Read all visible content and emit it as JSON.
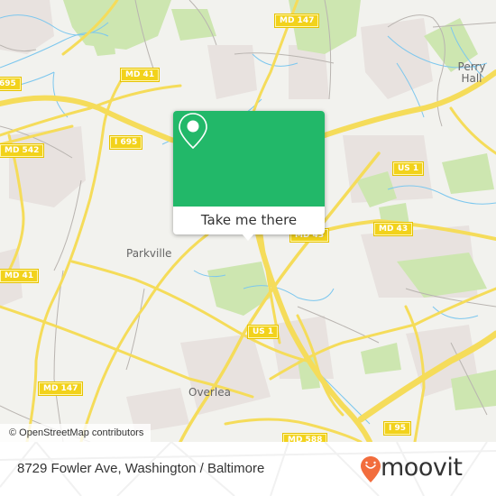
{
  "map": {
    "colors": {
      "background": "#f2f2ee",
      "park": "#cde6b0",
      "residential": "#e8e2df",
      "road_major": "#f5dc5a",
      "road_minor": "#b9b4b0",
      "water": "#7cc7ee",
      "shield": "#f2d21b",
      "accent": "#22b869",
      "brand": "#f26d3d"
    },
    "road_shields": [
      {
        "id": "md147-top",
        "label": "MD 147"
      },
      {
        "id": "md41-top",
        "label": "MD 41"
      },
      {
        "id": "i695-left",
        "label": "695"
      },
      {
        "id": "i695",
        "label": "I 695"
      },
      {
        "id": "md542",
        "label": "MD 542"
      },
      {
        "id": "us1-top",
        "label": "US 1"
      },
      {
        "id": "md43",
        "label": "MD 43"
      },
      {
        "id": "md43-under",
        "label": "MD 43"
      },
      {
        "id": "md41-left",
        "label": "MD 41"
      },
      {
        "id": "us1-mid",
        "label": "US 1"
      },
      {
        "id": "md147-bottom",
        "label": "MD 147"
      },
      {
        "id": "i95",
        "label": "I 95"
      },
      {
        "id": "md588",
        "label": "MD 588"
      }
    ],
    "places": [
      {
        "id": "perry-hall",
        "label": "Perry\nHall"
      },
      {
        "id": "parkville",
        "label": "Parkville"
      },
      {
        "id": "overlea",
        "label": "Overlea"
      }
    ],
    "attribution": "© OpenStreetMap contributors"
  },
  "popup": {
    "icon": "location-pin-icon",
    "button_label": "Take me there"
  },
  "footer": {
    "address": "8729 Fowler Ave, Washington / Baltimore",
    "brand_name": "moovit",
    "brand_icon": "moovit-smile-pin-icon"
  }
}
